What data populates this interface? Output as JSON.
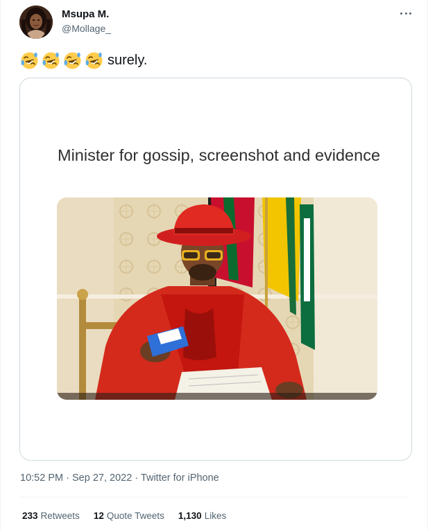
{
  "author": {
    "name": "Msupa M.",
    "handle": "@Mollage_"
  },
  "tweet": {
    "emoji": [
      "rolling-on-floor-laughing",
      "rolling-on-floor-laughing",
      "rolling-on-floor-laughing",
      "rolling-on-floor-laughing"
    ],
    "text": "surely."
  },
  "media": {
    "caption": "Minister for gossip, screenshot and evidence"
  },
  "meta": {
    "time": "10:52 PM",
    "date": "Sep 27, 2022",
    "source": "Twitter for iPhone",
    "separator": "·"
  },
  "stats": [
    {
      "count": "233",
      "label": "Retweets"
    },
    {
      "count": "12",
      "label": "Quote Tweets"
    },
    {
      "count": "1,130",
      "label": "Likes"
    }
  ],
  "colors": {
    "text": "#0f1419",
    "secondary": "#536471",
    "border": "#cfd9de",
    "divider": "#eff3f4",
    "hat_red": "#d11f1f"
  }
}
